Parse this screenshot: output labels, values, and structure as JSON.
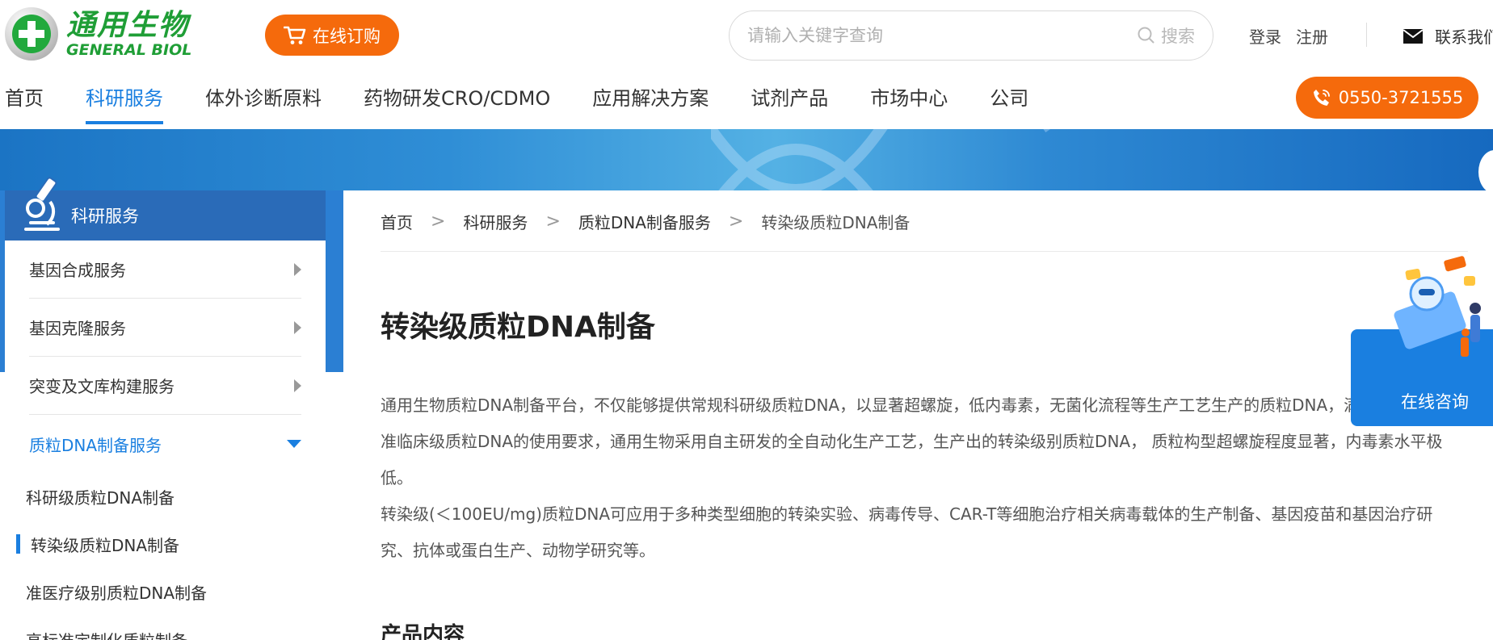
{
  "header": {
    "logo_cn": "通用生物",
    "logo_en": "GENERAL BIOL",
    "order_label": "在线订购",
    "search_placeholder": "请输入关键字查询",
    "search_button": "搜索",
    "login": "登录",
    "register": "注册",
    "contact": "联系我们",
    "phone": "0550-3721555"
  },
  "nav": {
    "items": [
      "首页",
      "科研服务",
      "体外诊断原料",
      "药物研发CRO/CDMO",
      "应用解决方案",
      "试剂产品",
      "市场中心",
      "公司"
    ],
    "active": "科研服务"
  },
  "sidebar": {
    "title": "科研服务",
    "items": [
      {
        "label": "基因合成服务"
      },
      {
        "label": "基因克隆服务"
      },
      {
        "label": "突变及文库构建服务"
      },
      {
        "label": "质粒DNA制备服务"
      }
    ],
    "sub_items": [
      {
        "label": "科研级质粒DNA制备"
      },
      {
        "label": "转染级质粒DNA制备"
      },
      {
        "label": "准医疗级别质粒DNA制备"
      },
      {
        "label": "高标准定制化质粒制备"
      }
    ]
  },
  "breadcrumb": {
    "items": [
      "首页",
      "科研服务",
      "质粒DNA制备服务",
      "转染级质粒DNA制备"
    ],
    "separator": ">"
  },
  "main": {
    "title": "转染级质粒DNA制备",
    "paragraph1": "通用生物质粒DNA制备平台，不仅能够提供常规科研级质粒DNA，以显著超螺旋，低内毒素，无菌化流程等生产工艺生产的质粒DNA，满足了转染级和准临床级质粒DNA的使用要求，通用生物采用自主研发的全自动化生产工艺，生产出的转染级别质粒DNA， 质粒构型超螺旋程度显著，内毒素水平极低。",
    "paragraph2": "转染级(＜100EU/mg)质粒DNA可应用于多种类型细胞的转染实验、病毒传导、CAR-T等细胞治疗相关病毒载体的生产制备、基因疫苗和基因治疗研究、抗体或蛋白生产、动物学研究等。",
    "section_title": "产品内容"
  },
  "float": {
    "consult_label": "在线咨询"
  },
  "colors": {
    "brand_green": "#1f9e36",
    "accent_orange": "#f56a0c",
    "primary_blue": "#1a7fe0"
  }
}
